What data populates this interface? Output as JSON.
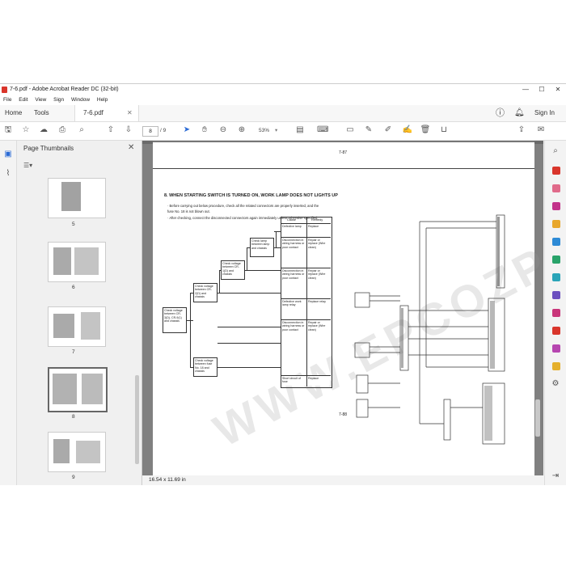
{
  "window": {
    "title": "7-6.pdf - Adobe Acrobat Reader DC (32-bit)",
    "minimize": "—",
    "maximize": "☐",
    "close": "✕"
  },
  "menu": [
    "File",
    "Edit",
    "View",
    "Sign",
    "Window",
    "Help"
  ],
  "tabs": {
    "home": "Home",
    "tools": "Tools",
    "document": "7-6.pdf",
    "sign_in": "Sign In"
  },
  "toolbar": {
    "current_page": "8",
    "page_total": "/ 9",
    "zoom": "53%"
  },
  "thumbnails": {
    "header": "Page Thumbnails",
    "close": "✕",
    "items": [
      {
        "label": "5"
      },
      {
        "label": "6"
      },
      {
        "label": "7"
      },
      {
        "label": "8"
      },
      {
        "label": "9"
      }
    ]
  },
  "document": {
    "page_top_number": "7-87",
    "page_bottom_number": "7-88",
    "section_title": "8. WHEN STARTING SWITCH IS TURNED ON, WORK LAMP DOES NOT LIGHTS UP",
    "notes": [
      "· Before carrying out below procedure, check all the related connectors are properly inserted, and the",
      "  fuse No. 18 is not blown out.",
      "· After checking, connect the disconnected connectors again immediately unless otherwise specified."
    ],
    "cause_header": "Cause",
    "remedy_header": "Remedy",
    "causes": [
      {
        "cause": "Defective lamp",
        "remedy": "Replace"
      },
      {
        "cause": "Disconnection in wiring harness or poor contact",
        "remedy": "Repair or replace (Wire clean)"
      },
      {
        "cause": "Disconnection in wiring harness or poor contact",
        "remedy": "Repair or replace (Wire clean)"
      },
      {
        "cause": "Defective work lamp relay",
        "remedy": "Replace relay"
      },
      {
        "cause": "Disconnection in wiring harness or poor contact",
        "remedy": "Repair or replace (Wire clean)"
      },
      {
        "cause": "Short circuit of fuse",
        "remedy": "Replace"
      }
    ],
    "check_boxes": [
      "Check voltage between CR-3(D), CR-9(1) and chassis",
      "Check voltage between CR-2(D) and chassis",
      "Check voltage between CR-1(D) and chassis",
      "Check lamp between lamp and chassis",
      "Check voltage between fuse No. 18 and chassis"
    ],
    "watermark": "WWW.EPCOZPO.COM"
  },
  "status": {
    "size": "16.54 x 11.69 in"
  }
}
